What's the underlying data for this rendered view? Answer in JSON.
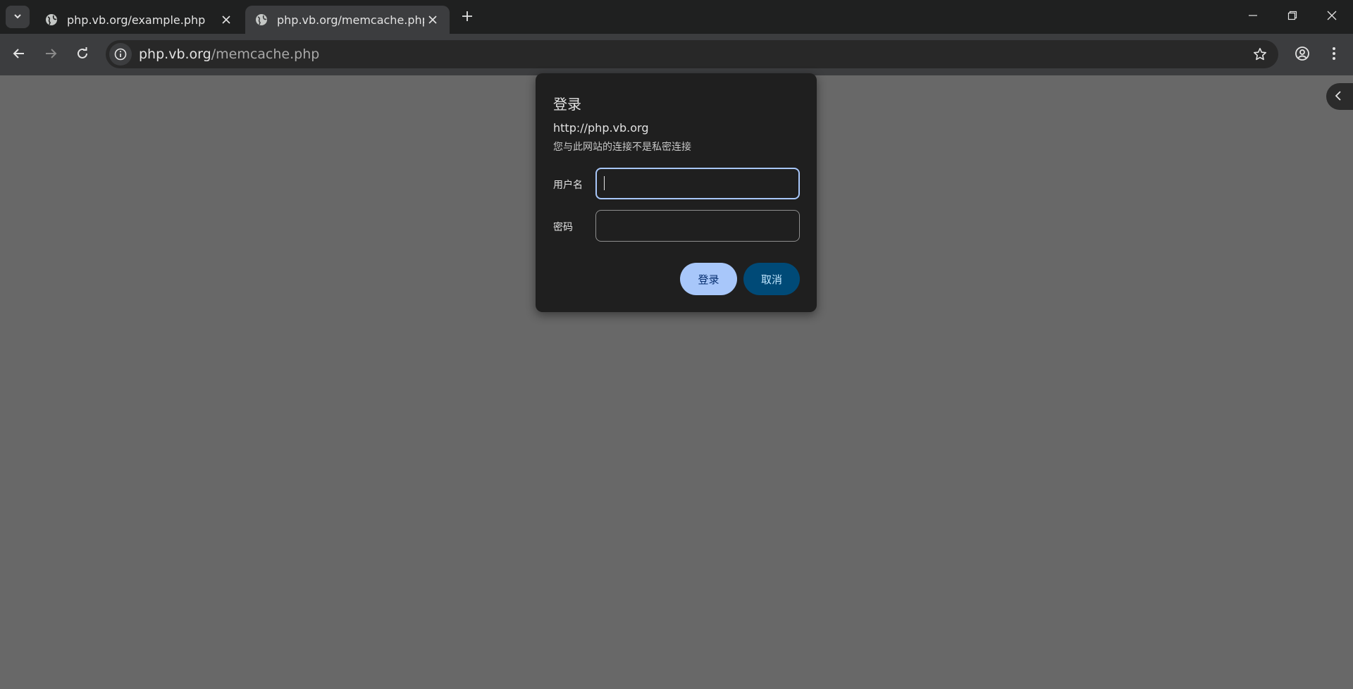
{
  "tabs": [
    {
      "title": "php.vb.org/example.php",
      "active": false
    },
    {
      "title": "php.vb.org/memcache.php",
      "active": true
    }
  ],
  "toolbar": {
    "url_host": "php.vb.org",
    "url_path": "/memcache.php"
  },
  "dialog": {
    "title": "登录",
    "host": "http://php.vb.org",
    "warning": "您与此网站的连接不是私密连接",
    "username_label": "用户名",
    "username_value": "",
    "password_label": "密码",
    "password_value": "",
    "login_button": "登录",
    "cancel_button": "取消"
  },
  "icons": {
    "tab_search": "chevron-down-icon",
    "favicon": "globe-icon",
    "tab_close": "close-icon",
    "new_tab": "plus-icon",
    "back": "arrow-left-icon",
    "forward": "arrow-right-icon",
    "reload": "reload-icon",
    "site_info": "info-icon",
    "bookmark": "star-icon",
    "profile": "account-circle-icon",
    "menu": "kebab-menu-icon",
    "side_panel": "chevron-left-icon"
  },
  "colors": {
    "accent": "#a8c7fa",
    "cancel_bg": "#004a77",
    "page_bg": "#686868",
    "dialog_bg": "#1f1f1f"
  }
}
